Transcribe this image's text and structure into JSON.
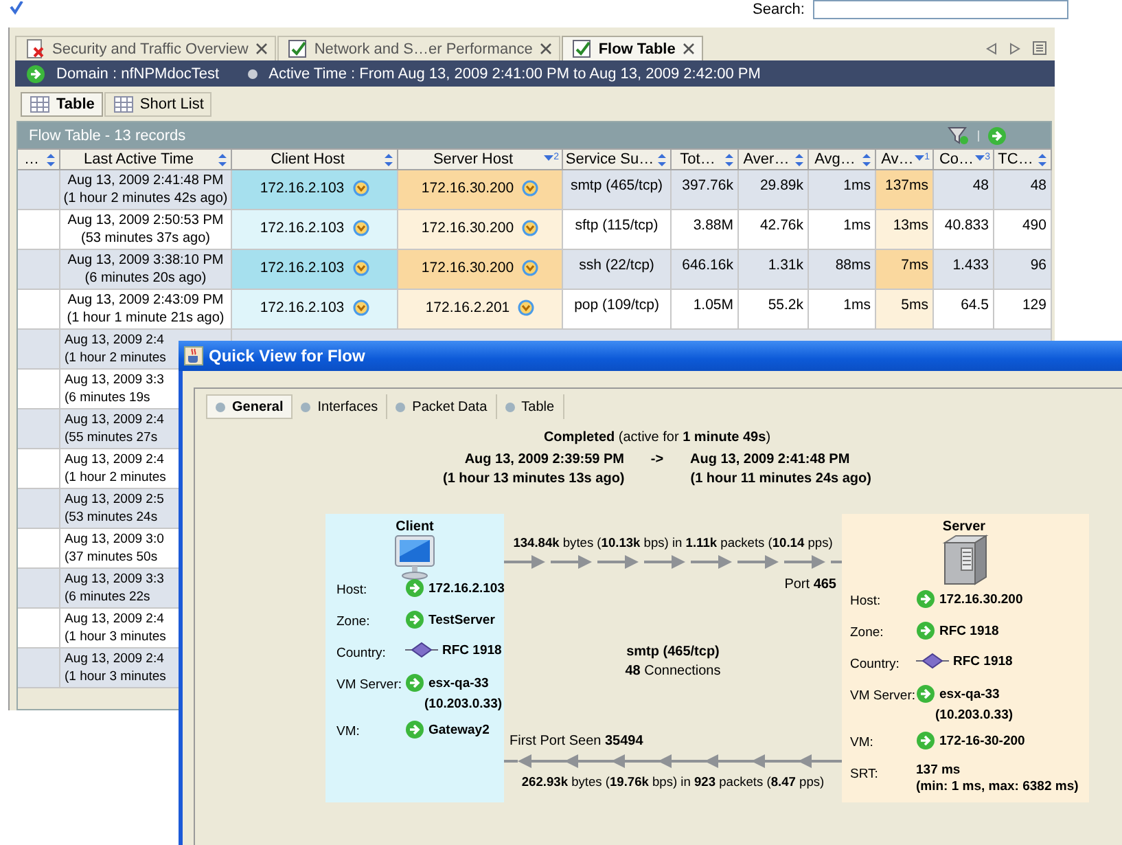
{
  "toolbar": {
    "search_label": "Search:"
  },
  "tabs": [
    {
      "label": "Security and Traffic Overview",
      "selected": false
    },
    {
      "label": "Network and S…er Performance",
      "selected": false
    },
    {
      "label": "Flow Table",
      "selected": true
    }
  ],
  "domain_bar": {
    "domain": "Domain : nfNPMdocTest",
    "active_time": "Active Time : From Aug 13, 2009 2:41:00 PM to Aug 13, 2009 2:42:00 PM"
  },
  "view_tabs": [
    {
      "label": "Table",
      "selected": true
    },
    {
      "label": "Short List",
      "selected": false
    }
  ],
  "table": {
    "title": "Flow Table - 13 records",
    "columns": [
      {
        "label": "…",
        "sorted": false
      },
      {
        "label": "Last Active Time",
        "sorted": false
      },
      {
        "label": "Client Host",
        "sorted": false
      },
      {
        "label": "Server Host",
        "sorted": true,
        "rank": "2"
      },
      {
        "label": "Service Su…",
        "sorted": false
      },
      {
        "label": "Tot…",
        "sorted": false
      },
      {
        "label": "Aver…",
        "sorted": false
      },
      {
        "label": "Avg…",
        "sorted": false
      },
      {
        "label": "Av…",
        "sorted": true,
        "rank": "1"
      },
      {
        "label": "Co…",
        "sorted": true,
        "rank": "3"
      },
      {
        "label": "TC…",
        "sorted": false
      }
    ],
    "rows": [
      {
        "cells": [
          "Aug 13, 2009 2:41:48 PM",
          "(1 hour 2 minutes 42s ago)",
          "172.16.2.103",
          "172.16.30.200",
          "smtp (465/tcp)",
          "397.76k",
          "29.89k",
          "1ms",
          "137ms",
          "48",
          "48"
        ]
      },
      {
        "cells": [
          "Aug 13, 2009 2:50:53 PM",
          "(53 minutes 37s ago)",
          "172.16.2.103",
          "172.16.30.200",
          "sftp (115/tcp)",
          "3.88M",
          "42.76k",
          "1ms",
          "13ms",
          "40.833",
          "490"
        ]
      },
      {
        "cells": [
          "Aug 13, 2009 3:38:10 PM",
          "(6 minutes 20s ago)",
          "172.16.2.103",
          "172.16.30.200",
          "ssh (22/tcp)",
          "646.16k",
          "1.31k",
          "88ms",
          "7ms",
          "1.433",
          "96"
        ]
      },
      {
        "cells": [
          "Aug 13, 2009 2:43:09 PM",
          "(1 hour 1 minute 21s ago)",
          "172.16.2.103",
          "172.16.2.201",
          "pop (109/tcp)",
          "1.05M",
          "55.2k",
          "1ms",
          "5ms",
          "64.5",
          "129"
        ]
      },
      {
        "cells": [
          "Aug 13, 2009 2:4",
          "(1 hour 2 minutes"
        ]
      },
      {
        "cells": [
          "Aug 13, 2009 3:3",
          "(6 minutes 19s"
        ]
      },
      {
        "cells": [
          "Aug 13, 2009 2:4",
          "(55 minutes 27s"
        ]
      },
      {
        "cells": [
          "Aug 13, 2009 2:4",
          "(1 hour 2 minutes"
        ]
      },
      {
        "cells": [
          "Aug 13, 2009 2:5",
          "(53 minutes 24s"
        ]
      },
      {
        "cells": [
          "Aug 13, 2009 3:0",
          "(37 minutes 50s"
        ]
      },
      {
        "cells": [
          "Aug 13, 2009 3:3",
          "(6 minutes 22s"
        ]
      },
      {
        "cells": [
          "Aug 13, 2009 2:4",
          "(1 hour 3 minutes"
        ]
      },
      {
        "cells": [
          "Aug 13, 2009 2:4",
          "(1 hour 3 minutes"
        ]
      }
    ]
  },
  "quick_view": {
    "title": "Quick View for Flow",
    "tabs": [
      {
        "label": "General",
        "selected": true
      },
      {
        "label": "Interfaces",
        "selected": false
      },
      {
        "label": "Packet Data",
        "selected": false
      },
      {
        "label": "Table",
        "selected": false
      }
    ],
    "status": "**Completed** (active for **1 minute 49s**)",
    "start_time": "Aug 13, 2009 2:39:59 PM",
    "time_arrow": "->",
    "end_time": "Aug 13, 2009 2:41:48 PM",
    "start_ago": "(1 hour 13 minutes 13s ago)",
    "end_ago": "(1 hour 11 minutes 24s ago)",
    "client": {
      "title": "Client",
      "fields": [
        {
          "label": "Host:",
          "kind": "link",
          "lines": [
            "172.16.2.103"
          ]
        },
        {
          "label": "Zone:",
          "kind": "link",
          "lines": [
            "TestServer"
          ]
        },
        {
          "label": "Country:",
          "kind": "country",
          "lines": [
            "RFC 1918"
          ]
        },
        {
          "label": "VM Server:",
          "kind": "link",
          "lines": [
            "esx-qa-33",
            "(10.203.0.33)"
          ]
        },
        {
          "label": "VM:",
          "kind": "link",
          "lines": [
            "Gateway2"
          ]
        }
      ]
    },
    "server": {
      "title": "Server",
      "fields": [
        {
          "label": "Host:",
          "kind": "link",
          "lines": [
            "172.16.30.200"
          ]
        },
        {
          "label": "Zone:",
          "kind": "link",
          "lines": [
            "RFC 1918"
          ]
        },
        {
          "label": "Country:",
          "kind": "country",
          "lines": [
            "RFC 1918"
          ]
        },
        {
          "label": "VM Server:",
          "kind": "link",
          "lines": [
            "esx-qa-33",
            "(10.203.0.33)"
          ]
        },
        {
          "label": "VM:",
          "kind": "link",
          "lines": [
            "172-16-30-200"
          ]
        },
        {
          "label": "SRT:",
          "kind": "plain",
          "lines": [
            "137 ms",
            "(min: 1 ms, max: 6382 ms)"
          ]
        }
      ]
    },
    "outbound": "**134.84k** bytes (**10.13k** bps) in **1.11k** packets (**10.14** pps)",
    "port": "Port **465**",
    "service": "smtp (465/tcp)",
    "connections": "**48** Connections",
    "first_port": "First Port Seen **35494**",
    "inbound": "**262.93k** bytes (**19.76k** bps) in **923** packets (**8.47** pps)"
  }
}
